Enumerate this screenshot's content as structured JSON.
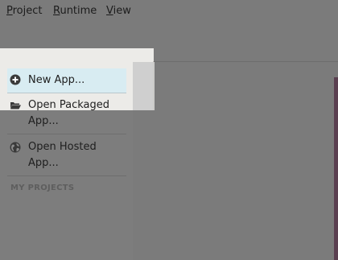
{
  "menubar": {
    "items": [
      {
        "first": "P",
        "rest": "roject"
      },
      {
        "first": "R",
        "rest": "untime"
      },
      {
        "first": "V",
        "rest": "iew"
      }
    ]
  },
  "sidebar": {
    "actions": [
      {
        "label": "New App...",
        "icon": "plus-circle-icon"
      },
      {
        "label": "Open Packaged App...",
        "icon": "folder-open-icon"
      },
      {
        "label": "Open Hosted App...",
        "icon": "globe-icon"
      }
    ],
    "section_header": "MY PROJECTS"
  },
  "colors": {
    "overlay": "#7b7b7b",
    "highlight_panel": "#ecebe8",
    "selected_item": "#d8ecf2",
    "accent_strip": "#5a3f50"
  }
}
